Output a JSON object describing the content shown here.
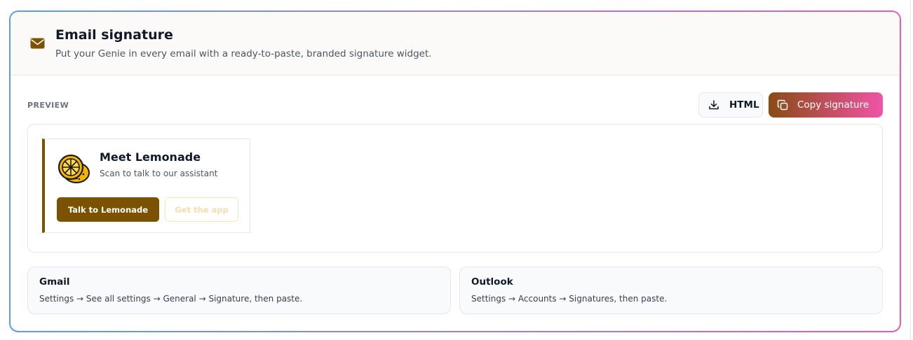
{
  "header": {
    "icon": "envelope-icon",
    "title": "Email signature",
    "subtitle": "Put your Genie in every email with a ready-to-paste, branded signature widget."
  },
  "preview": {
    "label": "PREVIEW",
    "html_button": {
      "icon": "download-icon",
      "label": "HTML"
    },
    "copy_button": {
      "icon": "copy-icon",
      "label": "Copy signature"
    }
  },
  "signature": {
    "avatar_icon": "lemon-icon",
    "name": "Meet Lemonade",
    "tagline": "Scan to talk to our assistant",
    "primary_button": "Talk to Lemonade",
    "secondary_button": "Get the app"
  },
  "instructions": [
    {
      "title": "Gmail",
      "steps": "Settings → See all settings → General → Signature, then paste."
    },
    {
      "title": "Outlook",
      "steps": "Settings → Accounts → Signatures, then paste."
    }
  ],
  "colors": {
    "brand_brown": "#7a5200",
    "gradient_start": "#5b9bea",
    "gradient_end": "#e85ab9",
    "copy_gradient_start": "#8a4b14",
    "copy_gradient_end": "#ef55a7"
  }
}
